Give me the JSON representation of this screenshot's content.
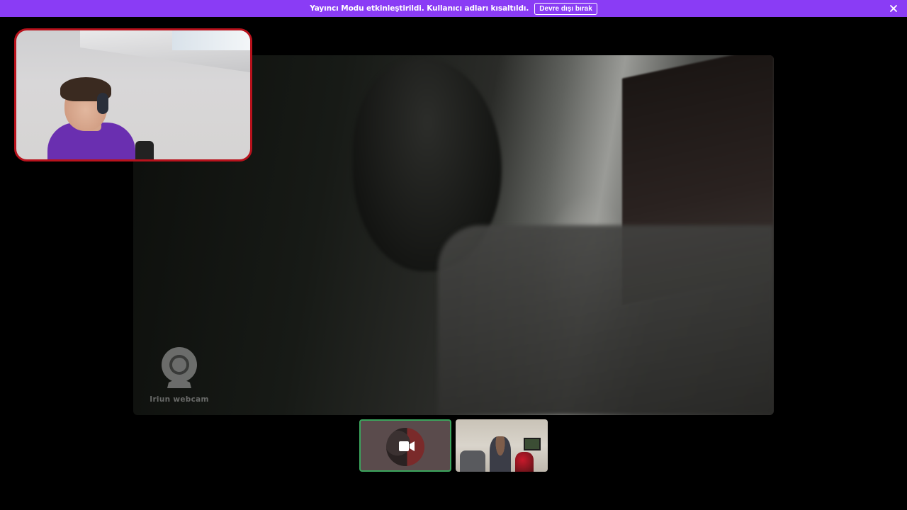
{
  "notice_bar": {
    "message": "Yayıncı Modu etkinleştirildi. Kullanıcı adları kısaltıldı.",
    "disable_button": "Devre dışı bırak",
    "background_color": "#8a3cf5",
    "close_icon": "close-icon"
  },
  "main_stream": {
    "watermark_label": "Iriun webcam",
    "watermark_icon": "webcam-icon"
  },
  "self_view": {
    "border_color": "#b8121c"
  },
  "participants": [
    {
      "state": "camera-off",
      "icon": "video-camera-icon",
      "border_color": "#3ba55d"
    },
    {
      "state": "video"
    }
  ]
}
